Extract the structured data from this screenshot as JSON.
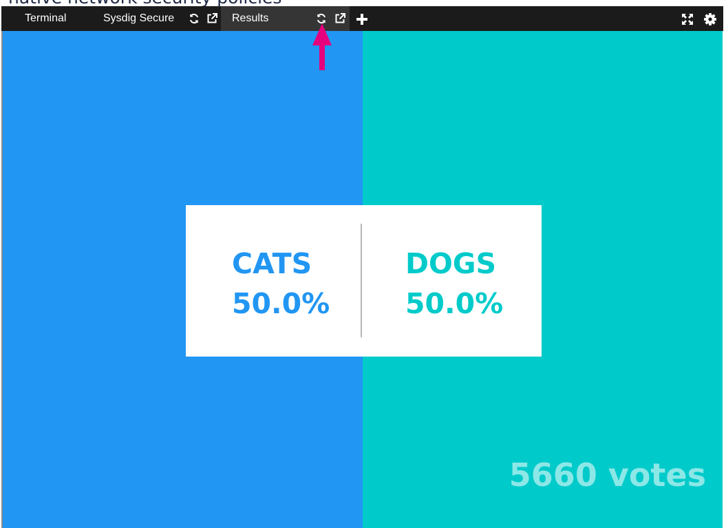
{
  "page": {
    "heading_partial": "native network security policies"
  },
  "tabs": [
    {
      "label": "Terminal"
    },
    {
      "label": "Sysdig Secure"
    },
    {
      "label": "Results"
    }
  ],
  "icons": {
    "reload": "refresh-icon",
    "popout": "external-link-icon",
    "add": "plus-icon",
    "fullscreen": "expand-icon",
    "settings": "gear-icon"
  },
  "results": {
    "options": [
      {
        "name": "CATS",
        "percent": "50.0%",
        "color": "#2196f3"
      },
      {
        "name": "DOGS",
        "percent": "50.0%",
        "color": "#00cbca"
      }
    ],
    "votes": "5660 votes"
  },
  "colors": {
    "tabbar": "#1b1b1b",
    "active_tab": "#353535",
    "cats_panel": "#2196f3",
    "dogs_panel": "#00cbca",
    "arrow": "#e6007e"
  }
}
